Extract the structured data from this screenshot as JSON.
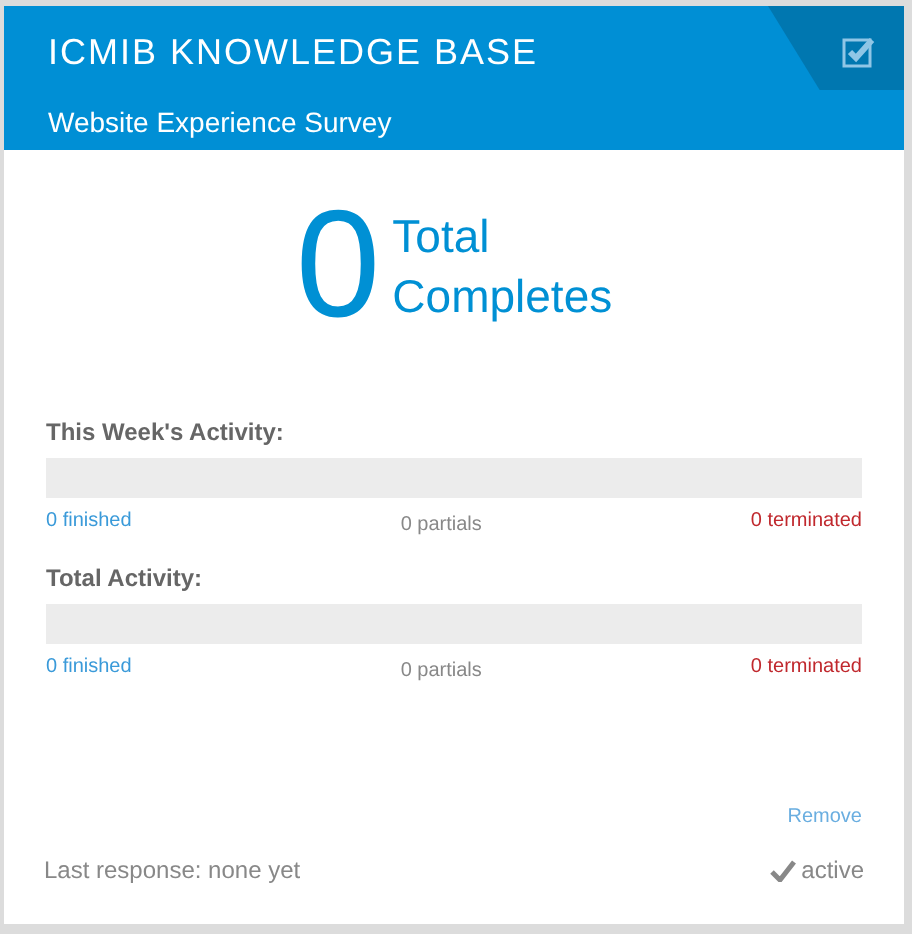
{
  "header": {
    "title": "ICMIB KNOWLEDGE BASE",
    "subtitle": "Website Experience Survey",
    "checked": true
  },
  "completes": {
    "count": "0",
    "label_line_1": "Total",
    "label_line_2": "Completes"
  },
  "activities": [
    {
      "title": "This Week's Activity:",
      "level": 0,
      "finished": "0 finished",
      "partials": "0 partials",
      "terminated": "0 terminated"
    },
    {
      "title": "Total Activity:",
      "level": 0,
      "finished": "0 finished",
      "partials": "0 partials",
      "terminated": "0 terminated"
    }
  ],
  "remove_link": "Remove",
  "footer": {
    "last_response": "Last response: none yet",
    "status": "active"
  }
}
